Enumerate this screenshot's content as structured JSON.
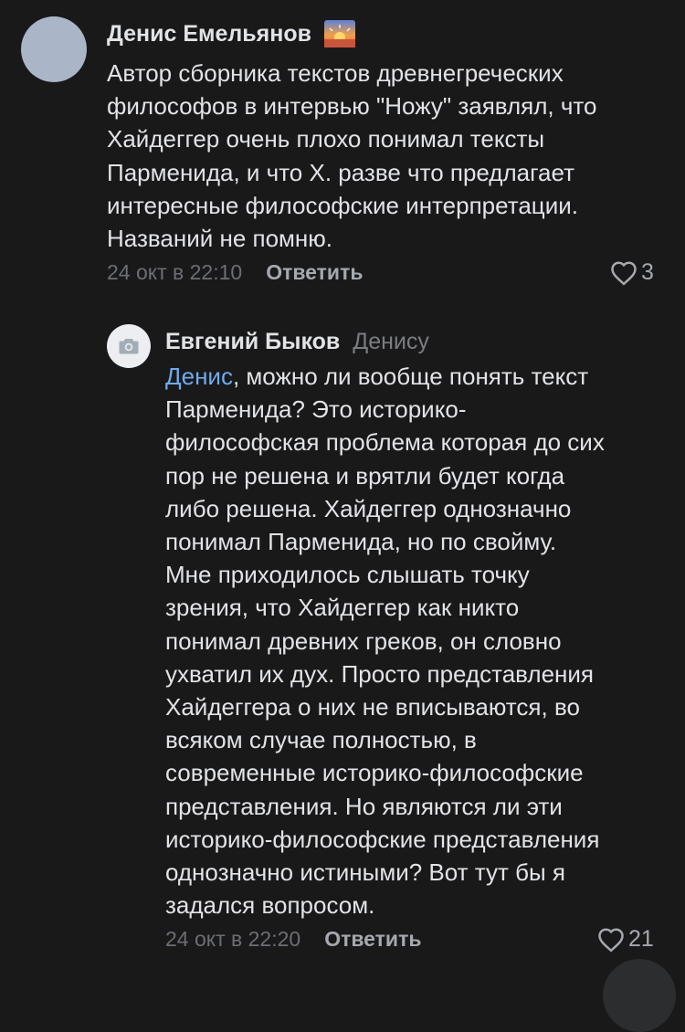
{
  "comments": [
    {
      "author": "Денис Емельянов",
      "author_emoji_icon": "sunrise-emoji-icon",
      "text_lines": [
        "Автор сборника текстов древнегреческих",
        "философов в интервью \"Ножу\" заявлял, что",
        "Хайдеггер очень плохо понимал тексты",
        "Парменида, и что Х. разве что предлагает",
        "интересные философские интерпретации.",
        "Названий не помню."
      ],
      "timestamp": "24 окт в 22:10",
      "reply_label": "Ответить",
      "likes": "3"
    },
    {
      "author": "Евгений Быков",
      "reply_to": "Денису",
      "avatar_icon": "camera-icon",
      "mention": "Денис",
      "text_lines": [
        ", можно ли вообще понять текст",
        "Парменида? Это историко-",
        "философская проблема которая до сих",
        "пор не решена и врятли будет когда",
        "либо решена. Хайдеггер  однозначно",
        "понимал Парменида, но по свойму.",
        "Мне приходилось слышать точку",
        "зрения, что Хайдеггер как никто",
        "понимал древних греков, он словно",
        "ухватил их дух. Просто представления",
        "Хайдеггера о них не вписываются, во",
        "всяком случае полностью, в",
        "современные историко-философские",
        "представления. Но являются ли эти",
        "историко-философские представления",
        "однозначно истиными? Вот тут бы я",
        "задался вопросом."
      ],
      "timestamp": "24 окт в 22:20",
      "reply_label": "Ответить",
      "likes": "21"
    }
  ],
  "colors": {
    "background": "#19191a",
    "text": "#e1e3e6",
    "secondary": "#7a7d82",
    "link": "#71aaeb"
  }
}
